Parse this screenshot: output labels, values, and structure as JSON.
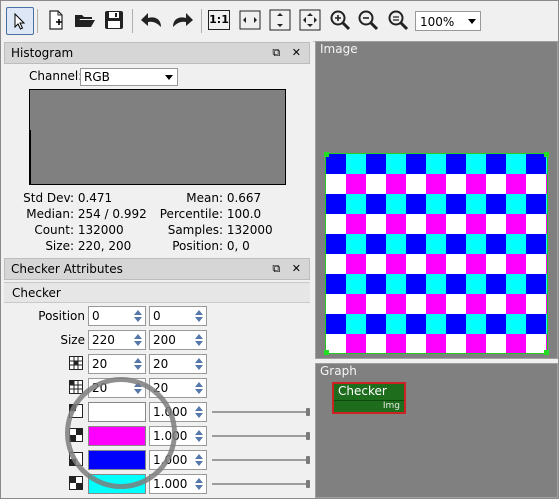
{
  "toolbar": {
    "tools": [
      "select-tool",
      "new-node",
      "open",
      "save",
      "undo",
      "redo",
      "zoom-1-1",
      "fit-width",
      "fit-height",
      "fit-all",
      "zoom-in",
      "zoom-out",
      "zoom-reset"
    ],
    "one_to_one_label": "1:1",
    "zoom_value": "100%"
  },
  "histogram": {
    "title": "Histogram",
    "channel_label": "Channel:",
    "channel_value": "RGB",
    "stats": {
      "std_dev": {
        "label": "Std Dev:",
        "value": "0.471"
      },
      "mean": {
        "label": "Mean:",
        "value": "0.667"
      },
      "median": {
        "label": "Median:",
        "value": "254 / 0.992"
      },
      "percentile": {
        "label": "Percentile:",
        "value": "100.0"
      },
      "count": {
        "label": "Count:",
        "value": "132000"
      },
      "samples": {
        "label": "Samples:",
        "value": "132000"
      },
      "size": {
        "label": "Size:",
        "value": "220, 200"
      },
      "position": {
        "label": "Position:",
        "value": "0, 0"
      }
    }
  },
  "checker_attributes": {
    "title": "Checker Attributes",
    "section": "Checker",
    "position": {
      "label": "Position",
      "x": "0",
      "y": "0"
    },
    "size": {
      "label": "Size",
      "w": "220",
      "h": "200"
    },
    "cells_a": {
      "x": "20",
      "y": "20"
    },
    "cells_b": {
      "x": "20",
      "y": "20"
    },
    "colors": [
      {
        "color": "#ffffff",
        "value": "1.000"
      },
      {
        "color": "#ff00ff",
        "value": "1.000"
      },
      {
        "color": "#0000ff",
        "value": "1.000"
      },
      {
        "color": "#00ffff",
        "value": "1.000"
      }
    ]
  },
  "image_pane": {
    "title": "Image",
    "checker_colors": [
      "#0000ff",
      "#00ffff",
      "#ffffff",
      "#ff00ff"
    ]
  },
  "graph_pane": {
    "title": "Graph",
    "node_title": "Checker",
    "node_port": "Img"
  },
  "dock_buttons": "⧉ ✕"
}
